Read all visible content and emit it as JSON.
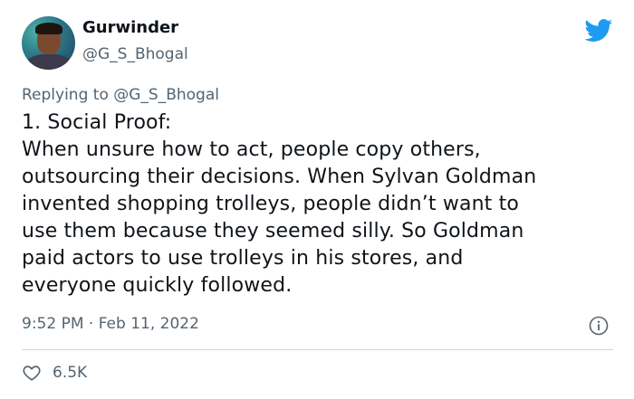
{
  "author": {
    "display_name": "Gurwinder",
    "handle": "@G_S_Bhogal"
  },
  "reply": {
    "prefix": "Replying to ",
    "mention": "@G_S_Bhogal"
  },
  "tweet": {
    "lines": [
      "1. Social Proof:",
      "When unsure how to act, people copy others,",
      "outsourcing their decisions. When Sylvan Goldman",
      "invented shopping trolleys, people didn’t want to",
      "use them because they seemed silly. So Goldman",
      "paid actors to use trolleys in his stores, and",
      "everyone quickly followed."
    ]
  },
  "meta": {
    "timestamp": "9:52 PM · Feb 11, 2022"
  },
  "engagement": {
    "likes": "6.5K"
  },
  "icons": {
    "brand": "twitter-bird-icon",
    "info": "info-icon",
    "like": "heart-icon"
  },
  "colors": {
    "brand": "#1d9bf0",
    "text_primary": "#0f1419",
    "text_secondary": "#536471",
    "divider": "#cfd9de"
  }
}
